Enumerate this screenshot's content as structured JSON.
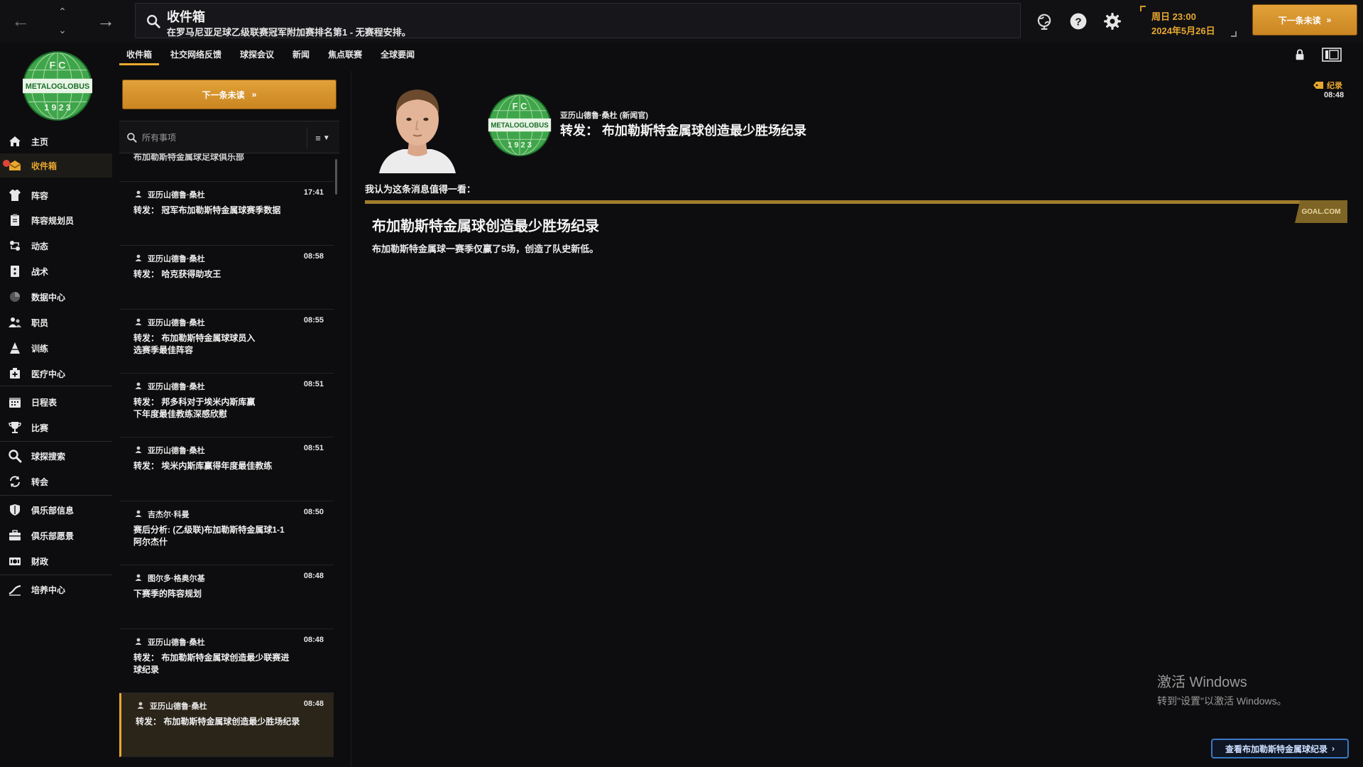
{
  "topbar": {
    "title": "收件箱",
    "subtitle": "在罗马尼亚足球乙级联赛冠军附加赛排名第1 - 无赛程安排。",
    "date_day": "周日 23:00",
    "date_date": "2024年5月26日",
    "next_unread": "下一条未读",
    "icons": [
      "back-arrow-icon",
      "up-chevron-icon",
      "down-chevron-icon",
      "forward-arrow-icon",
      "search-icon",
      "globe-icon",
      "help-icon",
      "gear-icon"
    ]
  },
  "sidebar": {
    "items": [
      {
        "label": "主页",
        "icon": "home-icon"
      },
      {
        "label": "收件箱",
        "icon": "inbox-icon"
      },
      {
        "label": "阵容",
        "icon": "jersey-icon"
      },
      {
        "label": "阵容规划员",
        "icon": "clipboard-icon"
      },
      {
        "label": "动态",
        "icon": "dynamics-icon"
      },
      {
        "label": "战术",
        "icon": "tactics-icon"
      },
      {
        "label": "数据中心",
        "icon": "data-icon"
      },
      {
        "label": "职员",
        "icon": "staff-icon"
      },
      {
        "label": "训练",
        "icon": "training-icon"
      },
      {
        "label": "医疗中心",
        "icon": "medical-icon"
      },
      {
        "label": "日程表",
        "icon": "calendar-icon"
      },
      {
        "label": "比赛",
        "icon": "trophy-icon"
      },
      {
        "label": "球探搜索",
        "icon": "scout-search-icon"
      },
      {
        "label": "转会",
        "icon": "transfer-icon"
      },
      {
        "label": "俱乐部信息",
        "icon": "shield-icon"
      },
      {
        "label": "俱乐部愿景",
        "icon": "briefcase-icon"
      },
      {
        "label": "财政",
        "icon": "finance-icon"
      },
      {
        "label": "培养中心",
        "icon": "development-icon"
      }
    ]
  },
  "tabs": [
    "收件箱",
    "社交网络反馈",
    "球探会议",
    "新闻",
    "焦点联赛",
    "全球要闻"
  ],
  "list": {
    "next_unread": "下一条未读",
    "filter_placeholder": "所有事项",
    "partial_text": "布加勒斯特金属球足球俱乐部",
    "messages": [
      {
        "sender": "亚历山德鲁·桑杜",
        "time": "17:41",
        "subject": "转发： 冠军布加勒斯特金属球赛季数据"
      },
      {
        "sender": "亚历山德鲁·桑杜",
        "time": "08:58",
        "subject": "转发： 哈克获得助攻王"
      },
      {
        "sender": "亚历山德鲁·桑杜",
        "time": "08:55",
        "subject": "转发： 布加勒斯特金属球球员入\n选赛季最佳阵容"
      },
      {
        "sender": "亚历山德鲁·桑杜",
        "time": "08:51",
        "subject": "转发： 邦多科对于埃米内斯库赢\n下年度最佳教练深感欣慰"
      },
      {
        "sender": "亚历山德鲁·桑杜",
        "time": "08:51",
        "subject": "转发： 埃米内斯库赢得年度最佳教练"
      },
      {
        "sender": "吉杰尔·科曼",
        "time": "08:50",
        "subject": "赛后分析: (乙级联)布加勒斯特金属球1-1\n阿尔杰什"
      },
      {
        "sender": "图尔多·格奥尔基",
        "time": "08:48",
        "subject": "下赛季的阵容规划"
      },
      {
        "sender": "亚历山德鲁·桑杜",
        "time": "08:48",
        "subject": "转发： 布加勒斯特金属球创造最少联赛进\n球纪录"
      },
      {
        "sender": "亚历山德鲁·桑杜",
        "time": "08:48",
        "subject": "转发： 布加勒斯特金属球创造最少胜场纪录"
      }
    ],
    "selected_index": 8
  },
  "detail": {
    "from": "亚历山德鲁·桑杜 (新闻官)",
    "title": "转发：  布加勒斯特金属球创造最少胜场纪录",
    "record_label": "纪录",
    "record_time": "08:48",
    "intro": "我认为这条消息值得一看：",
    "source": "GOAL.COM",
    "headline": "布加勒斯特金属球创造最少胜场纪录",
    "body": "布加勒斯特金属球一赛季仅赢了5场，创造了队史新低。",
    "view_more": "查看布加勒斯特金属球纪录"
  },
  "club_logo": {
    "top_text": "F C",
    "band_text": "METALOGLOBUS",
    "year": "1 9 2 3"
  },
  "watermark": {
    "title": "激活 Windows",
    "subtitle": "转到\"设置\"以激活 Windows。"
  },
  "colors": {
    "accent": "#e8a82e",
    "background": "#0d0d0f",
    "logo_green": "#3fa54a"
  }
}
